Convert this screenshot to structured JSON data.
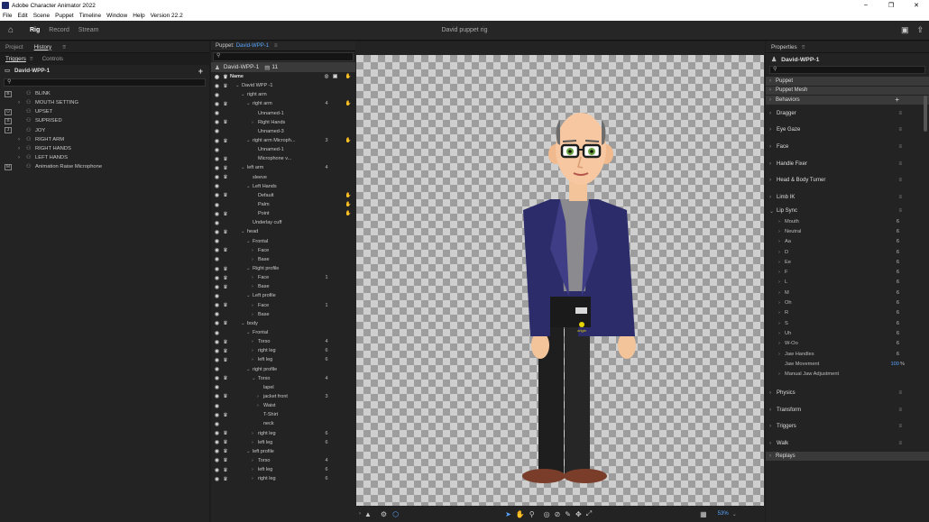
{
  "titlebar": {
    "title": "Adobe Character Animator 2022",
    "min": "–",
    "max": "❐",
    "close": "✕"
  },
  "menu": [
    "File",
    "Edit",
    "Scene",
    "Puppet",
    "Timeline",
    "Window",
    "Help",
    "Version 22.2"
  ],
  "workspace": {
    "tabs": [
      "Rig",
      "Record",
      "Stream"
    ],
    "active": "Rig",
    "doc_title": "David puppet rig"
  },
  "left": {
    "tabs": [
      "Project",
      "History"
    ],
    "subtabs": [
      "Triggers",
      "Controls"
    ],
    "puppet": "David-WPP-1",
    "triggers": [
      {
        "key": "B",
        "arrow": "",
        "label": "BLINK"
      },
      {
        "key": "",
        "arrow": "›",
        "label": "MOUTH SETTING"
      },
      {
        "key": "U",
        "arrow": "",
        "label": "UPSET"
      },
      {
        "key": "S",
        "arrow": "",
        "label": "SUPRISED"
      },
      {
        "key": "J",
        "arrow": "",
        "label": "JOY"
      },
      {
        "key": "",
        "arrow": "›",
        "label": "RIGHT ARM"
      },
      {
        "key": "",
        "arrow": "›",
        "label": "RIGHT HANDS"
      },
      {
        "key": "",
        "arrow": "›",
        "label": "LEFT HANDS"
      },
      {
        "key": "M",
        "arrow": "",
        "label": "Animation Raise Microphone"
      }
    ]
  },
  "puppet_panel": {
    "tab_label": "Puppet:",
    "tab_name": "David-WPP-1",
    "puppet_row": "David-WPP-1",
    "puppet_count": "11",
    "header": "Name",
    "rows": [
      {
        "i": 1,
        "a": "⌄",
        "n": "David WPP -1",
        "c1": "",
        "tag": false
      },
      {
        "i": 2,
        "a": "⌄",
        "n": "right arm",
        "c1": "",
        "tag": false
      },
      {
        "i": 3,
        "a": "⌄",
        "n": "right arm",
        "c1": "4",
        "tag": true
      },
      {
        "i": 4,
        "a": "",
        "n": "Unnamed-1",
        "c1": "",
        "tag": false
      },
      {
        "i": 4,
        "a": "›",
        "n": "Right Hands",
        "c1": "",
        "tag": false
      },
      {
        "i": 4,
        "a": "",
        "n": "Unnamed-3",
        "c1": "",
        "tag": false
      },
      {
        "i": 3,
        "a": "⌄",
        "n": "right arm Microph...",
        "c1": "3",
        "tag": true
      },
      {
        "i": 4,
        "a": "",
        "n": "Unnamed-1",
        "c1": "",
        "tag": false
      },
      {
        "i": 4,
        "a": "",
        "n": "Microphone v...",
        "c1": "",
        "tag": false
      },
      {
        "i": 2,
        "a": "⌄",
        "n": "left arm",
        "c1": "4",
        "tag": false
      },
      {
        "i": 3,
        "a": "",
        "n": "sleeve",
        "c1": "",
        "tag": false
      },
      {
        "i": 3,
        "a": "⌄",
        "n": "Left Hands",
        "c1": "",
        "tag": false
      },
      {
        "i": 4,
        "a": "",
        "n": "Default",
        "c1": "",
        "tag": true
      },
      {
        "i": 4,
        "a": "",
        "n": "Palm",
        "c1": "",
        "tag": true
      },
      {
        "i": 4,
        "a": "",
        "n": "Point",
        "c1": "",
        "tag": true
      },
      {
        "i": 3,
        "a": "",
        "n": "Underlay cuff",
        "c1": "",
        "tag": false
      },
      {
        "i": 2,
        "a": "⌄",
        "n": "head",
        "c1": "",
        "tag": false
      },
      {
        "i": 3,
        "a": "⌄",
        "n": "Frontal",
        "c1": "",
        "tag": false
      },
      {
        "i": 4,
        "a": "›",
        "n": "Face",
        "c1": "",
        "tag": false
      },
      {
        "i": 4,
        "a": "›",
        "n": "Base",
        "c1": "",
        "tag": false
      },
      {
        "i": 3,
        "a": "⌄",
        "n": "Right profile",
        "c1": "",
        "tag": false
      },
      {
        "i": 4,
        "a": "›",
        "n": "Face",
        "c1": "1",
        "tag": false
      },
      {
        "i": 4,
        "a": "›",
        "n": "Base",
        "c1": "",
        "tag": false
      },
      {
        "i": 3,
        "a": "⌄",
        "n": "Left profile",
        "c1": "",
        "tag": false
      },
      {
        "i": 4,
        "a": "›",
        "n": "Face",
        "c1": "1",
        "tag": false
      },
      {
        "i": 4,
        "a": "›",
        "n": "Base",
        "c1": "",
        "tag": false
      },
      {
        "i": 2,
        "a": "⌄",
        "n": "body",
        "c1": "",
        "tag": false
      },
      {
        "i": 3,
        "a": "⌄",
        "n": "Frontal",
        "c1": "",
        "tag": false
      },
      {
        "i": 4,
        "a": "›",
        "n": "Torso",
        "c1": "4",
        "tag": false
      },
      {
        "i": 4,
        "a": "›",
        "n": "right leg",
        "c1": "6",
        "tag": false
      },
      {
        "i": 4,
        "a": "›",
        "n": "left leg",
        "c1": "6",
        "tag": false
      },
      {
        "i": 3,
        "a": "⌄",
        "n": "right profile",
        "c1": "",
        "tag": false
      },
      {
        "i": 4,
        "a": "⌄",
        "n": "Torso",
        "c1": "4",
        "tag": false
      },
      {
        "i": 5,
        "a": "",
        "n": "lapel",
        "c1": "",
        "tag": false
      },
      {
        "i": 5,
        "a": "›",
        "n": "jacket front",
        "c1": "3",
        "tag": false
      },
      {
        "i": 5,
        "a": "›",
        "n": "Waist",
        "c1": "",
        "tag": false
      },
      {
        "i": 5,
        "a": "",
        "n": "T-Shirt",
        "c1": "",
        "tag": false
      },
      {
        "i": 5,
        "a": "",
        "n": "neck",
        "c1": "",
        "tag": false
      },
      {
        "i": 4,
        "a": "›",
        "n": "right leg",
        "c1": "6",
        "tag": false
      },
      {
        "i": 4,
        "a": "›",
        "n": "left leg",
        "c1": "6",
        "tag": false
      },
      {
        "i": 3,
        "a": "⌄",
        "n": "left profile",
        "c1": "",
        "tag": false
      },
      {
        "i": 4,
        "a": "›",
        "n": "Torso",
        "c1": "4",
        "tag": false
      },
      {
        "i": 4,
        "a": "›",
        "n": "left leg",
        "c1": "6",
        "tag": false
      },
      {
        "i": 4,
        "a": "›",
        "n": "right leg",
        "c1": "6",
        "tag": false
      }
    ]
  },
  "canvas": {
    "origin_label": "origin",
    "zoom": "53%"
  },
  "properties": {
    "title": "Properties",
    "puppet": "David-WPP-1",
    "sections": [
      "Puppet",
      "Puppet Mesh",
      "Behaviors"
    ],
    "behaviors_top": [
      "Dragger",
      "Eye Gaze",
      "Face",
      "Handle Fixer",
      "Head & Body Turner",
      "Limb IK"
    ],
    "lip_sync_title": "Lip Sync",
    "lip_sync": [
      {
        "n": "Mouth",
        "v": "6"
      },
      {
        "n": "Neutral",
        "v": "6"
      },
      {
        "n": "Aa",
        "v": "6"
      },
      {
        "n": "D",
        "v": "6"
      },
      {
        "n": "Ee",
        "v": "6"
      },
      {
        "n": "F",
        "v": "6"
      },
      {
        "n": "L",
        "v": "6"
      },
      {
        "n": "M",
        "v": "6"
      },
      {
        "n": "Oh",
        "v": "6"
      },
      {
        "n": "R",
        "v": "6"
      },
      {
        "n": "S",
        "v": "6"
      },
      {
        "n": "Uh",
        "v": "6"
      },
      {
        "n": "W-Oo",
        "v": "6"
      },
      {
        "n": "Jaw Handles",
        "v": "6"
      }
    ],
    "jaw_movement": {
      "n": "Jaw Movement",
      "v": "100",
      "unit": "%"
    },
    "manual_jaw": "Manual Jaw Adjustment",
    "behaviors_bottom": [
      "Physics",
      "Transform",
      "Triggers",
      "Walk"
    ],
    "replays": "Replays"
  }
}
